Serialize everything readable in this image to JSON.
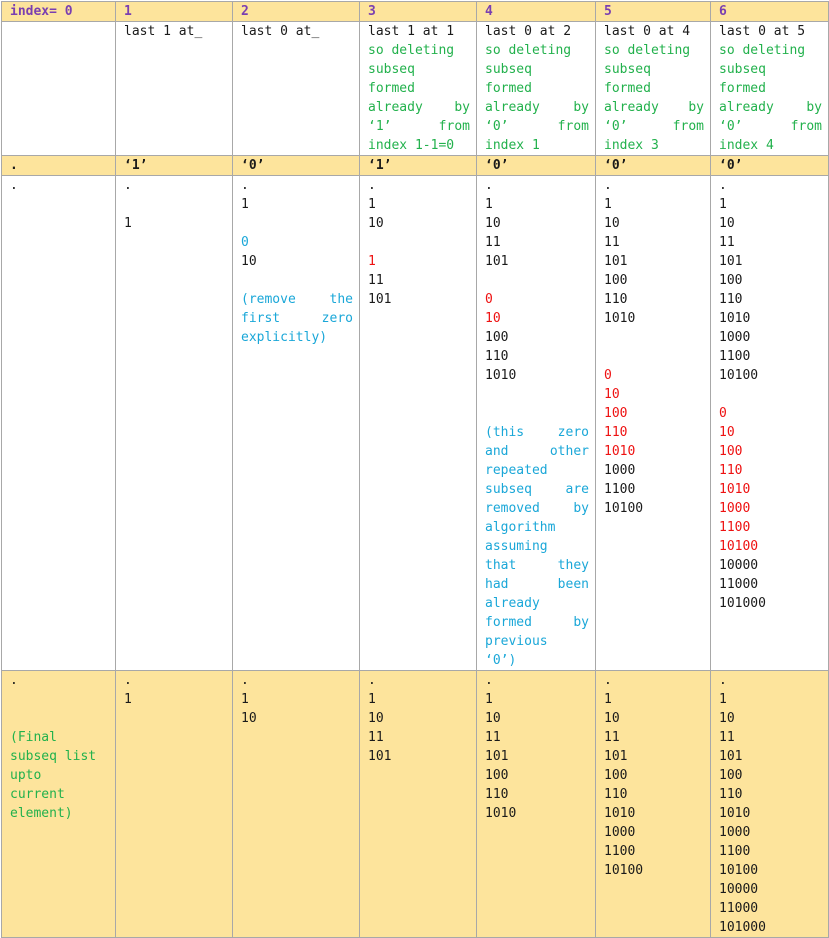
{
  "header": [
    "index= 0",
    "1",
    "2",
    "3",
    "4",
    "5",
    "6"
  ],
  "descriptions": [
    [],
    [
      {
        "t": "last 1 at_",
        "c": "black"
      }
    ],
    [
      {
        "t": "last 0 at_",
        "c": "black"
      }
    ],
    [
      {
        "t": "last 1 at 1",
        "c": "black"
      },
      {
        "t": "so deleting",
        "c": "green"
      },
      {
        "t": "subseq",
        "c": "green"
      },
      {
        "t": "formed",
        "c": "green"
      },
      {
        "t": "already by",
        "c": "green",
        "j": true
      },
      {
        "t": "‘1’ from",
        "c": "green",
        "j": true
      },
      {
        "t": "index 1-1=0",
        "c": "green"
      }
    ],
    [
      {
        "t": "last 0 at 2",
        "c": "black"
      },
      {
        "t": "so deleting",
        "c": "green"
      },
      {
        "t": "subseq",
        "c": "green"
      },
      {
        "t": "formed",
        "c": "green"
      },
      {
        "t": "already by",
        "c": "green",
        "j": true
      },
      {
        "t": "‘0’ from",
        "c": "green",
        "j": true
      },
      {
        "t": "index 1",
        "c": "green"
      }
    ],
    [
      {
        "t": "last 0 at 4",
        "c": "black"
      },
      {
        "t": "so deleting",
        "c": "green"
      },
      {
        "t": "subseq",
        "c": "green"
      },
      {
        "t": "formed",
        "c": "green"
      },
      {
        "t": "already by",
        "c": "green",
        "j": true
      },
      {
        "t": "‘0’ from",
        "c": "green",
        "j": true
      },
      {
        "t": "index 3",
        "c": "green"
      }
    ],
    [
      {
        "t": "last 0 at 5",
        "c": "black"
      },
      {
        "t": "so deleting",
        "c": "green"
      },
      {
        "t": "subseq",
        "c": "green"
      },
      {
        "t": "formed",
        "c": "green"
      },
      {
        "t": "already by",
        "c": "green",
        "j": true
      },
      {
        "t": "‘0’ from",
        "c": "green",
        "j": true
      },
      {
        "t": "index 4",
        "c": "green"
      }
    ]
  ],
  "chars": [
    ".",
    "‘1’",
    "‘0’",
    "‘1’",
    "‘0’",
    "‘0’",
    "‘0’"
  ],
  "work": [
    [
      {
        "t": "."
      }
    ],
    [
      {
        "t": "."
      },
      {
        "t": ""
      },
      {
        "t": "1"
      }
    ],
    [
      {
        "t": "."
      },
      {
        "t": "1"
      },
      {
        "t": ""
      },
      {
        "t": "0",
        "c": "blue"
      },
      {
        "t": "10"
      },
      {
        "t": ""
      },
      {
        "t": "(remove the",
        "c": "blue",
        "j": true
      },
      {
        "t": "first zero",
        "c": "blue",
        "j": true
      },
      {
        "t": "explicitly)",
        "c": "blue"
      }
    ],
    [
      {
        "t": "."
      },
      {
        "t": "1"
      },
      {
        "t": "10"
      },
      {
        "t": ""
      },
      {
        "t": "1",
        "c": "red"
      },
      {
        "t": "11"
      },
      {
        "t": "101"
      }
    ],
    [
      {
        "t": "."
      },
      {
        "t": "1"
      },
      {
        "t": "10"
      },
      {
        "t": "11"
      },
      {
        "t": "101"
      },
      {
        "t": ""
      },
      {
        "t": "0",
        "c": "red"
      },
      {
        "t": "10",
        "c": "red"
      },
      {
        "t": "100"
      },
      {
        "t": "110"
      },
      {
        "t": "1010"
      },
      {
        "t": ""
      },
      {
        "t": ""
      },
      {
        "t": "(this zero",
        "c": "blue",
        "j": true
      },
      {
        "t": "and other",
        "c": "blue",
        "j": true
      },
      {
        "t": "repeated",
        "c": "blue"
      },
      {
        "t": "subseq are",
        "c": "blue",
        "j": true
      },
      {
        "t": "removed by",
        "c": "blue",
        "j": true
      },
      {
        "t": "algorithm",
        "c": "blue"
      },
      {
        "t": "assuming",
        "c": "blue"
      },
      {
        "t": "that they",
        "c": "blue",
        "j": true
      },
      {
        "t": "had been",
        "c": "blue",
        "j": true
      },
      {
        "t": "already",
        "c": "blue"
      },
      {
        "t": "formed by",
        "c": "blue",
        "j": true
      },
      {
        "t": "previous",
        "c": "blue"
      },
      {
        "t": "‘0’)",
        "c": "blue"
      }
    ],
    [
      {
        "t": "."
      },
      {
        "t": "1"
      },
      {
        "t": "10"
      },
      {
        "t": "11"
      },
      {
        "t": "101"
      },
      {
        "t": "100"
      },
      {
        "t": "110"
      },
      {
        "t": "1010"
      },
      {
        "t": ""
      },
      {
        "t": ""
      },
      {
        "t": "0",
        "c": "red"
      },
      {
        "t": "10",
        "c": "red"
      },
      {
        "t": "100",
        "c": "red"
      },
      {
        "t": "110",
        "c": "red"
      },
      {
        "t": "1010",
        "c": "red"
      },
      {
        "t": "1000"
      },
      {
        "t": "1100"
      },
      {
        "t": "10100"
      }
    ],
    [
      {
        "t": "."
      },
      {
        "t": "1"
      },
      {
        "t": "10"
      },
      {
        "t": "11"
      },
      {
        "t": "101"
      },
      {
        "t": "100"
      },
      {
        "t": "110"
      },
      {
        "t": "1010"
      },
      {
        "t": "1000"
      },
      {
        "t": "1100"
      },
      {
        "t": "10100"
      },
      {
        "t": ""
      },
      {
        "t": "0",
        "c": "red"
      },
      {
        "t": "10",
        "c": "red"
      },
      {
        "t": "100",
        "c": "red"
      },
      {
        "t": "110",
        "c": "red"
      },
      {
        "t": "1010",
        "c": "red"
      },
      {
        "t": "1000",
        "c": "red"
      },
      {
        "t": "1100",
        "c": "red"
      },
      {
        "t": "10100",
        "c": "red"
      },
      {
        "t": "10000"
      },
      {
        "t": "11000"
      },
      {
        "t": "101000"
      }
    ]
  ],
  "final": [
    [
      {
        "t": "."
      },
      {
        "t": ""
      },
      {
        "t": ""
      },
      {
        "t": "(Final",
        "c": "green"
      },
      {
        "t": "subseq list",
        "c": "green"
      },
      {
        "t": "upto",
        "c": "green"
      },
      {
        "t": "current",
        "c": "green"
      },
      {
        "t": "element)",
        "c": "green"
      }
    ],
    [
      {
        "t": "."
      },
      {
        "t": "1"
      }
    ],
    [
      {
        "t": "."
      },
      {
        "t": "1"
      },
      {
        "t": "10"
      }
    ],
    [
      {
        "t": "."
      },
      {
        "t": "1"
      },
      {
        "t": "10"
      },
      {
        "t": "11"
      },
      {
        "t": "101"
      }
    ],
    [
      {
        "t": "."
      },
      {
        "t": "1"
      },
      {
        "t": "10"
      },
      {
        "t": "11"
      },
      {
        "t": "101"
      },
      {
        "t": "100"
      },
      {
        "t": "110"
      },
      {
        "t": "1010"
      }
    ],
    [
      {
        "t": "."
      },
      {
        "t": "1"
      },
      {
        "t": "10"
      },
      {
        "t": "11"
      },
      {
        "t": "101"
      },
      {
        "t": "100"
      },
      {
        "t": "110"
      },
      {
        "t": "1010"
      },
      {
        "t": "1000"
      },
      {
        "t": "1100"
      },
      {
        "t": "10100"
      }
    ],
    [
      {
        "t": "."
      },
      {
        "t": "1"
      },
      {
        "t": "10"
      },
      {
        "t": "11"
      },
      {
        "t": "101"
      },
      {
        "t": "100"
      },
      {
        "t": "110"
      },
      {
        "t": "1010"
      },
      {
        "t": "1000"
      },
      {
        "t": "1100"
      },
      {
        "t": "10100"
      },
      {
        "t": "10000"
      },
      {
        "t": "11000"
      },
      {
        "t": "101000"
      }
    ]
  ]
}
